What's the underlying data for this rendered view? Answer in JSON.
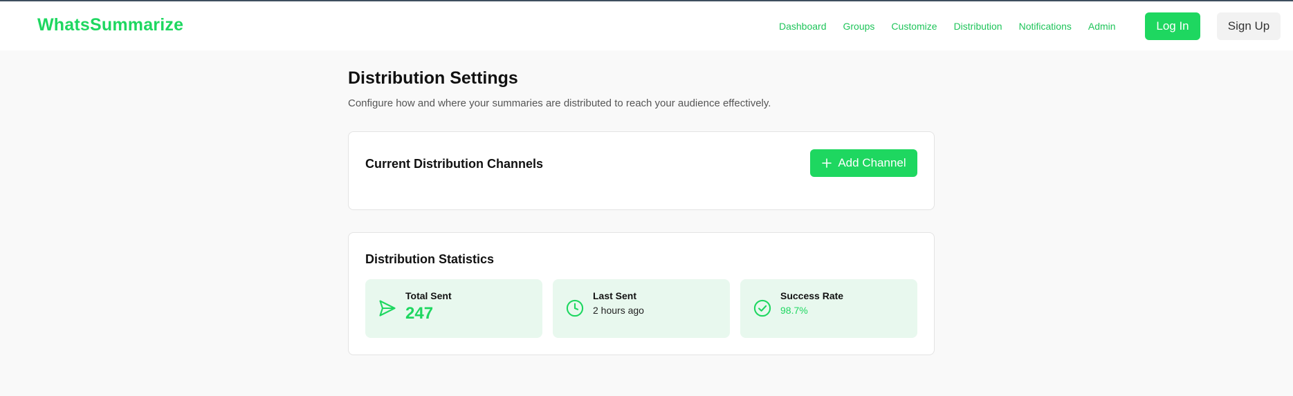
{
  "app": {
    "name": "WhatsSummarize"
  },
  "nav": {
    "links": [
      {
        "label": "Dashboard"
      },
      {
        "label": "Groups"
      },
      {
        "label": "Customize"
      },
      {
        "label": "Distribution"
      },
      {
        "label": "Notifications"
      },
      {
        "label": "Admin"
      }
    ],
    "login_label": "Log In",
    "signup_label": "Sign Up"
  },
  "page": {
    "title": "Distribution Settings",
    "description": "Configure how and where your summaries are distributed to reach your audience effectively."
  },
  "channels": {
    "title": "Current Distribution Channels",
    "add_label": "Add Channel",
    "add_icon": "plus-icon"
  },
  "stats": {
    "title": "Distribution Statistics",
    "items": [
      {
        "label": "Total Sent",
        "value": "247",
        "icon": "send-icon"
      },
      {
        "label": "Last Sent",
        "value": "2 hours ago",
        "icon": "clock-icon"
      },
      {
        "label": "Success Rate",
        "value": "98.7%",
        "icon": "check-circle-icon"
      }
    ]
  },
  "colors": {
    "accent": "#1ed760",
    "stat_bg": "#e8f8ee",
    "page_bg": "#f9f9f9"
  }
}
